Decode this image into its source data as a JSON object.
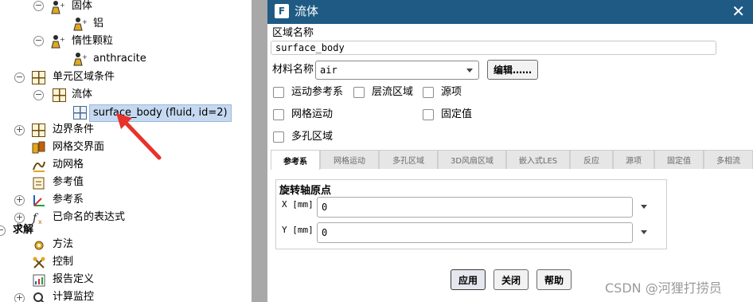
{
  "tree": {
    "items": [
      {
        "label": "固体"
      },
      {
        "label": "铝"
      },
      {
        "label": "惰性颗粒"
      },
      {
        "label": "anthracite"
      },
      {
        "label": "单元区域条件"
      },
      {
        "label": "流体"
      },
      {
        "label": "surface_body (fluid, id=2)"
      },
      {
        "label": "边界条件"
      },
      {
        "label": "网格交界面"
      },
      {
        "label": "动网格"
      },
      {
        "label": "参考值"
      },
      {
        "label": "参考系"
      },
      {
        "label": "已命名的表达式"
      },
      {
        "label": "求解"
      },
      {
        "label": "方法"
      },
      {
        "label": "控制"
      },
      {
        "label": "报告定义"
      },
      {
        "label": "计算监控"
      }
    ]
  },
  "dialog": {
    "logo": "F",
    "title": "流体",
    "close": "✕",
    "zone_name_label": "区域名称",
    "zone_name_value": "surface_body",
    "material_label": "材料名称",
    "material_value": "air",
    "edit_button": "编辑……",
    "checkboxes": [
      {
        "label": "运动参考系",
        "checked": false
      },
      {
        "label": "层流区域",
        "checked": false
      },
      {
        "label": "源项",
        "checked": false
      },
      {
        "label": "网格运动",
        "checked": false
      },
      {
        "label": "固定值",
        "checked": false
      },
      {
        "label": "多孔区域",
        "checked": false
      }
    ],
    "tabs": [
      {
        "label": "参考系",
        "active": true
      },
      {
        "label": "网格运动"
      },
      {
        "label": "多孔区域"
      },
      {
        "label": "3D风扇区域"
      },
      {
        "label": "嵌入式LES"
      },
      {
        "label": "反应"
      },
      {
        "label": "源项"
      },
      {
        "label": "固定值"
      },
      {
        "label": "多相流"
      }
    ],
    "group_title": "旋转轴原点",
    "x_label": "X [mm]",
    "x_value": "0",
    "y_label": "Y [mm]",
    "y_value": "0",
    "apply": "应用",
    "close_btn": "关闭",
    "help": "帮助"
  },
  "watermark": "CSDN @河狸打捞员"
}
